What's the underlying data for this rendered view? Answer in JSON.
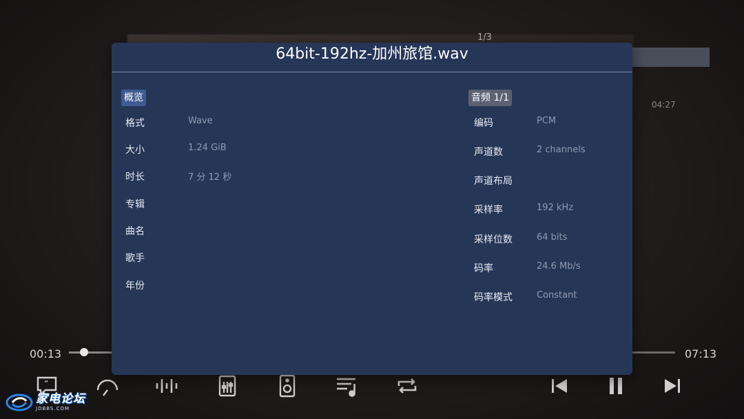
{
  "background": {
    "page_counter": "1/3",
    "duration_label": "04:27"
  },
  "player": {
    "elapsed": "00:13",
    "total": "07:13",
    "progress": 0.03
  },
  "controls": [
    {
      "icon": "subtitle-icon"
    },
    {
      "icon": "speed-icon"
    },
    {
      "icon": "audio-wave-icon"
    },
    {
      "icon": "equalizer-icon"
    },
    {
      "icon": "speaker-icon"
    },
    {
      "icon": "playlist-icon"
    },
    {
      "icon": "repeat-icon"
    },
    {
      "icon": "previous-icon"
    },
    {
      "icon": "pause-icon"
    },
    {
      "icon": "next-icon"
    }
  ],
  "watermark": {
    "text": "家电论坛",
    "sub": "JDBBS.COM"
  },
  "dialog": {
    "title": "64bit-192hz-加州旅馆.wav",
    "overview_tab": "概览",
    "audio_tab": "音频 1/1",
    "overview": [
      {
        "key": "格式",
        "value": "Wave"
      },
      {
        "key": "大小",
        "value": "1.24 GiB"
      },
      {
        "key": "时长",
        "value": "7 分 12 秒"
      },
      {
        "key": "专辑",
        "value": ""
      },
      {
        "key": "曲名",
        "value": ""
      },
      {
        "key": "歌手",
        "value": ""
      },
      {
        "key": "年份",
        "value": ""
      }
    ],
    "audio": [
      {
        "key": "编码",
        "value": "PCM"
      },
      {
        "key": "声道数",
        "value": "2 channels"
      },
      {
        "key": "声道布局",
        "value": ""
      },
      {
        "key": "采样率",
        "value": "192 kHz"
      },
      {
        "key": "采样位数",
        "value": "64 bits"
      },
      {
        "key": "码率",
        "value": "24.6 Mb/s"
      },
      {
        "key": "码率模式",
        "value": "Constant"
      }
    ]
  },
  "colors": {
    "dialog_bg": "#263657",
    "tab_active": "#3f5b93",
    "tab_audio": "#5a6272",
    "value_text": "#8f9bb3"
  }
}
